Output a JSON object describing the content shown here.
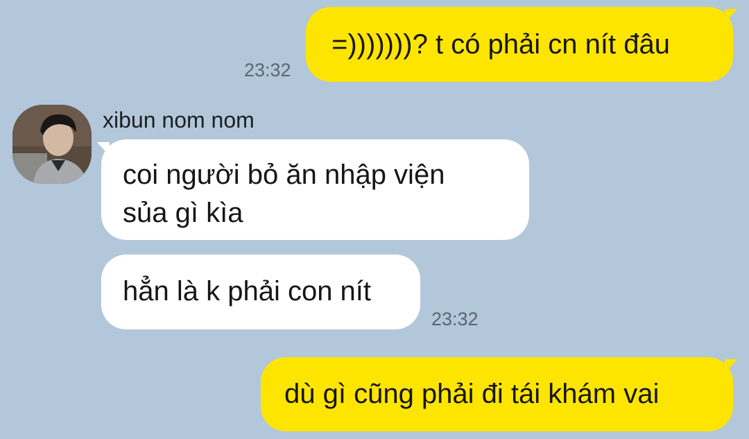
{
  "chat": {
    "messages": [
      {
        "id": "m1",
        "side": "out",
        "text": "=)))))))? t có phải cn nít đâu",
        "time": "23:32"
      },
      {
        "id": "m2",
        "side": "in",
        "sender": "xibun nom nom",
        "text_line1": "coi người bỏ ăn nhập viện",
        "text_line2": "sủa gì kìa"
      },
      {
        "id": "m3",
        "side": "in",
        "text": "hẳn là k phải con nít",
        "time": "23:32"
      },
      {
        "id": "m4",
        "side": "out",
        "text": "dù gì cũng phải đi tái khám vai"
      }
    ]
  },
  "colors": {
    "background": "#b2c7da",
    "outgoing_bubble": "#fee500",
    "incoming_bubble": "#ffffff",
    "timestamp": "#5b6670"
  },
  "icons": {
    "avatar": "profile-photo"
  }
}
